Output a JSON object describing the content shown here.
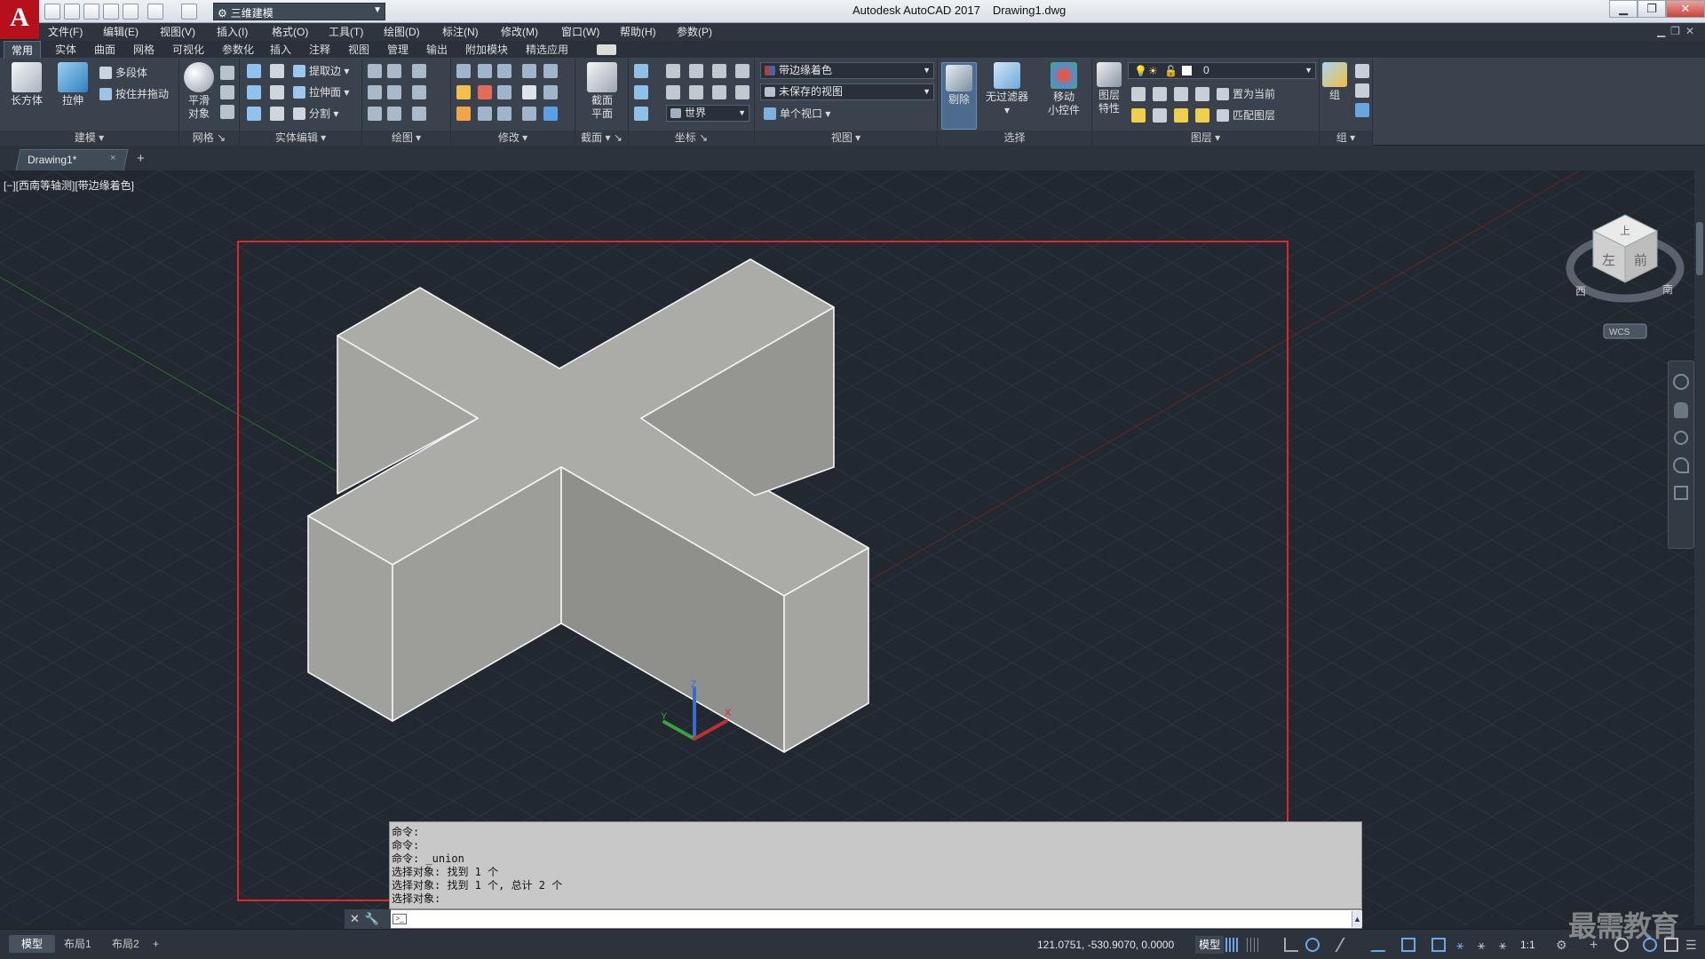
{
  "app": {
    "logo": "A",
    "title": "Autodesk AutoCAD 2017",
    "document": "Drawing1.dwg",
    "workspace": "三维建模"
  },
  "menu": [
    "文件(F)",
    "编辑(E)",
    "视图(V)",
    "插入(I)",
    "格式(O)",
    "工具(T)",
    "绘图(D)",
    "标注(N)",
    "修改(M)",
    "窗口(W)",
    "帮助(H)",
    "参数(P)"
  ],
  "ribbon_tabs": [
    "常用",
    "实体",
    "曲面",
    "网格",
    "可视化",
    "参数化",
    "插入",
    "注释",
    "视图",
    "管理",
    "输出",
    "附加模块",
    "精选应用"
  ],
  "ribbon": {
    "modeling": {
      "title": "建模",
      "box": "长方体",
      "extrude": "拉伸",
      "polysolid": "多段体",
      "presspull": "按住并拖动"
    },
    "mesh": {
      "title": "网格",
      "smooth1": "平滑",
      "smooth2": "对象"
    },
    "solid_edit": {
      "title": "实体编辑",
      "extract_edges": "提取边",
      "extrude_faces": "拉伸面",
      "separate": "分割"
    },
    "draw": {
      "title": "绘图"
    },
    "modify": {
      "title": "修改"
    },
    "section": {
      "title": "截面",
      "plane1": "截面",
      "plane2": "平面"
    },
    "coordinates": {
      "title": "坐标",
      "world": "世界"
    },
    "view": {
      "title": "视图",
      "visual_style": "带边缘着色",
      "named_view": "未保存的视图",
      "viewport_config": "单个视口"
    },
    "selection": {
      "title": "选择",
      "cull": "剔除",
      "no_filter": "无过滤器",
      "gizmo1": "移动",
      "gizmo2": "小控件"
    },
    "layers": {
      "title": "图层",
      "props1": "图层",
      "props2": "特性",
      "layer_value": "0",
      "set_current": "置为当前",
      "match": "匹配图层"
    },
    "groups": {
      "title": "组",
      "group": "组"
    }
  },
  "file_tab": {
    "name": "Drawing1*",
    "close": "×",
    "add": "+"
  },
  "viewport": {
    "label": "[−][西南等轴测][带边缘着色]",
    "viewcube": {
      "top": "上",
      "left": "左",
      "front": "前",
      "west": "西",
      "south": "南",
      "wcs": "WCS"
    },
    "ucs": {
      "x": "X",
      "y": "Y",
      "z": "Z"
    }
  },
  "command": {
    "history": [
      "命令:",
      "命令:",
      "命令: _union",
      "选择对象: 找到 1 个",
      "选择对象: 找到 1 个, 总计 2 个",
      "选择对象:"
    ],
    "input": ""
  },
  "layout_tabs": [
    "模型",
    "布局1",
    "布局2"
  ],
  "status": {
    "coords": "121.0751, -530.9070, 0.0000",
    "model": "模型",
    "scale": "1:1"
  },
  "watermark": "最需教育",
  "colors": {
    "accent_red": "#e0262c",
    "viewport_bg": "#212830",
    "solid_top": "#ababa8",
    "solid_left": "#a1a19e",
    "solid_right": "#949491"
  }
}
